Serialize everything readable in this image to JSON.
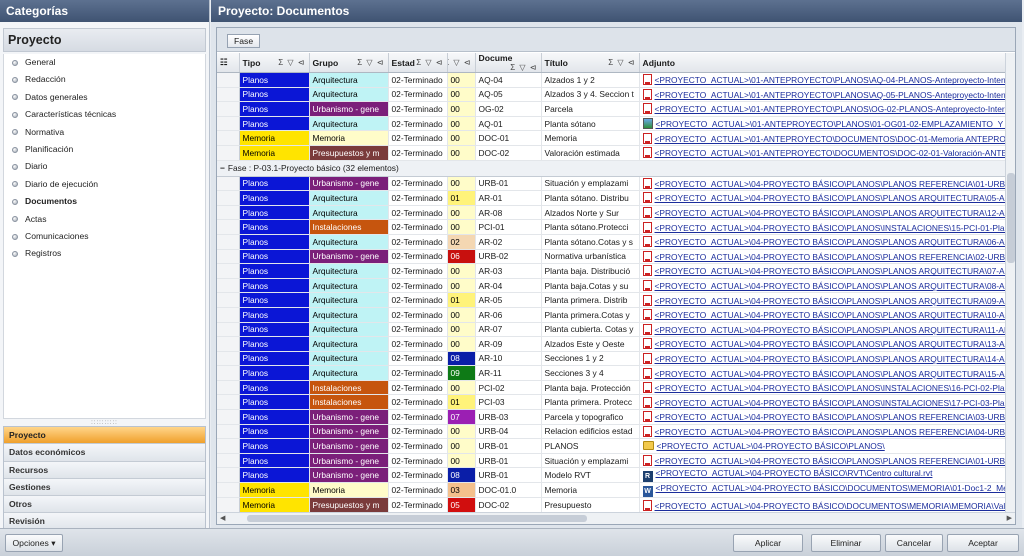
{
  "left_panel": {
    "header": "Categorías",
    "project_title": "Proyecto",
    "nav_items": [
      "General",
      "Redacción",
      "Datos generales",
      "Características técnicas",
      "Normativa",
      "Planificación",
      "Diario",
      "Diario de ejecución",
      "Documentos",
      "Actas",
      "Comunicaciones",
      "Registros"
    ],
    "active_item": "Documentos",
    "grip": "::::::::::",
    "bottom_nav": [
      "Proyecto",
      "Datos económicos",
      "Recursos",
      "Gestiones",
      "Otros",
      "Revisión"
    ],
    "bottom_active": "Proyecto"
  },
  "main": {
    "header": "Proyecto: Documentos",
    "group_chip": "Fase",
    "columns": [
      "Tipo",
      "Grupo",
      "Estad",
      "",
      "Docume",
      "Título",
      "Adjunto"
    ],
    "header_icons": "Σ ▽ ⊲",
    "rows_top": [
      {
        "tipo": "Planos",
        "tipo_color": "#0b16d6",
        "grupo": "Arquitectura",
        "grupo_color": "#bff3f5",
        "estado": "02-Terminado",
        "num": "00",
        "num_color": "#fffcc9",
        "doc": "AQ-04",
        "titulo": "Alzados 1 y 2",
        "icon": "pdf",
        "adjunto": "<PROYECTO_ACTUAL>\\01-ANTEPROYECTO\\PLANOS\\AQ-04-PLANOS-Anteproyecto-Internado.pdf"
      },
      {
        "tipo": "Planos",
        "tipo_color": "#0b16d6",
        "grupo": "Arquitectura",
        "grupo_color": "#bff3f5",
        "estado": "02-Terminado",
        "num": "00",
        "num_color": "#fffcc9",
        "doc": "AQ-05",
        "titulo": "Alzados 3 y 4. Seccion t",
        "icon": "pdf",
        "adjunto": "<PROYECTO_ACTUAL>\\01-ANTEPROYECTO\\PLANOS\\AQ-05-PLANOS-Anteproyecto-Internado.pdf"
      },
      {
        "tipo": "Planos",
        "tipo_color": "#0b16d6",
        "grupo": "Urbanismo - gene",
        "grupo_color": "#7b1f7a",
        "estado": "02-Terminado",
        "num": "00",
        "num_color": "#fffcc9",
        "doc": "OG-02",
        "titulo": "Parcela",
        "icon": "pdf",
        "adjunto": "<PROYECTO_ACTUAL>\\01-ANTEPROYECTO\\PLANOS\\OG-02-PLANOS-Anteproyecto-Internado.pdf"
      },
      {
        "tipo": "Planos",
        "tipo_color": "#0b16d6",
        "grupo": "Arquitectura",
        "grupo_color": "#bff3f5",
        "estado": "02-Terminado",
        "num": "00",
        "num_color": "#fffcc9",
        "doc": "AQ-01",
        "titulo": "Planta sótano",
        "icon": "img",
        "adjunto": "<PROYECTO_ACTUAL>\\01-ANTEPROYECTO\\PLANOS\\01-OG01-02-EMPLAZAMIENTO_Y_SITUACION"
      },
      {
        "tipo": "Memoria",
        "tipo_color": "#ffe400",
        "grupo": "Memoria",
        "grupo_color": "#fffcc9",
        "estado": "02-Terminado",
        "num": "00",
        "num_color": "#fffcc9",
        "doc": "DOC-01",
        "titulo": "Memoria",
        "icon": "pdf",
        "adjunto": "<PROYECTO_ACTUAL>\\01-ANTEPROYECTO\\DOCUMENTOS\\DOC-01-Memoria ANTEPROYECTO-Inter"
      },
      {
        "tipo": "Memoria",
        "tipo_color": "#ffe400",
        "grupo": "Presupuestos y m",
        "grupo_color": "#7a3b3b",
        "estado": "02-Terminado",
        "num": "00",
        "num_color": "#fffcc9",
        "doc": "DOC-02",
        "titulo": "Valoración estimada",
        "icon": "pdf",
        "adjunto": "<PROYECTO_ACTUAL>\\01-ANTEPROYECTO\\DOCUMENTOS\\DOC-02-01-Valoración-ANTEPROY"
      }
    ],
    "group_row": "Fase : P-03.1-Proyecto básico (32 elementos)",
    "rows_bottom": [
      {
        "tipo": "Planos",
        "tipo_color": "#0b16d6",
        "grupo": "Urbanismo - gene",
        "grupo_color": "#7b1f7a",
        "estado": "02-Terminado",
        "num": "00",
        "num_color": "#fffcc9",
        "doc": "URB-01",
        "titulo": "Situación y emplazami",
        "icon": "pdf",
        "adjunto": "<PROYECTO_ACTUAL>\\04-PROYECTO BÁSICO\\PLANOS\\PLANOS REFERENCIA\\01-URB-01-Situac"
      },
      {
        "tipo": "Planos",
        "tipo_color": "#0b16d6",
        "grupo": "Arquitectura",
        "grupo_color": "#bff3f5",
        "estado": "02-Terminado",
        "num": "01",
        "num_color": "#fff37a",
        "doc": "AR-01",
        "titulo": "Planta sótano. Distribu",
        "icon": "pdf",
        "adjunto": "<PROYECTO_ACTUAL>\\04-PROYECTO BÁSICO\\PLANOS\\PLANOS ARQUITECTURA\\05-AR-01-Plan"
      },
      {
        "tipo": "Planos",
        "tipo_color": "#0b16d6",
        "grupo": "Arquitectura",
        "grupo_color": "#bff3f5",
        "estado": "02-Terminado",
        "num": "00",
        "num_color": "#fffcc9",
        "doc": "AR-08",
        "titulo": "Alzados Norte y Sur",
        "icon": "pdf",
        "adjunto": "<PROYECTO_ACTUAL>\\04-PROYECTO BÁSICO\\PLANOS\\PLANOS ARQUITECTURA\\12-AR-08-ALZ"
      },
      {
        "tipo": "Planos",
        "tipo_color": "#0b16d6",
        "grupo": "Instalaciones",
        "grupo_color": "#c6550e",
        "estado": "02-Terminado",
        "num": "00",
        "num_color": "#fffcc9",
        "doc": "PCI-01",
        "titulo": "Planta sótano.Protecci",
        "icon": "pdf",
        "adjunto": "<PROYECTO_ACTUAL>\\04-PROYECTO BÁSICO\\PLANOS\\INSTALACIONES\\15-PCI-01-Planta sotar"
      },
      {
        "tipo": "Planos",
        "tipo_color": "#0b16d6",
        "grupo": "Arquitectura",
        "grupo_color": "#bff3f5",
        "estado": "02-Terminado",
        "num": "02",
        "num_color": "#f4d7b2",
        "doc": "AR-02",
        "titulo": "Planta sótano.Cotas y s",
        "icon": "pdf",
        "adjunto": "<PROYECTO_ACTUAL>\\04-PROYECTO BÁSICO\\PLANOS\\PLANOS ARQUITECTURA\\06-AR-02-Plan"
      },
      {
        "tipo": "Planos",
        "tipo_color": "#0b16d6",
        "grupo": "Urbanismo - gene",
        "grupo_color": "#7b1f7a",
        "estado": "02-Terminado",
        "num": "06",
        "num_color": "#c8100e",
        "doc": "URB-02",
        "titulo": "Normativa urbanística",
        "icon": "pdf",
        "adjunto": "<PROYECTO_ACTUAL>\\04-PROYECTO BÁSICO\\PLANOS\\PLANOS REFERENCIA\\02-URB-02-Norma"
      },
      {
        "tipo": "Planos",
        "tipo_color": "#0b16d6",
        "grupo": "Arquitectura",
        "grupo_color": "#bff3f5",
        "estado": "02-Terminado",
        "num": "00",
        "num_color": "#fffcc9",
        "doc": "AR-03",
        "titulo": "Planta baja. Distribució",
        "icon": "pdf",
        "adjunto": "<PROYECTO_ACTUAL>\\04-PROYECTO BÁSICO\\PLANOS\\PLANOS ARQUITECTURA\\07-AR-03-Plan"
      },
      {
        "tipo": "Planos",
        "tipo_color": "#0b16d6",
        "grupo": "Arquitectura",
        "grupo_color": "#bff3f5",
        "estado": "02-Terminado",
        "num": "00",
        "num_color": "#fffcc9",
        "doc": "AR-04",
        "titulo": "Planta baja.Cotas y su",
        "icon": "pdf",
        "adjunto": "<PROYECTO_ACTUAL>\\04-PROYECTO BÁSICO\\PLANOS\\PLANOS ARQUITECTURA\\08-AR-04-Plan"
      },
      {
        "tipo": "Planos",
        "tipo_color": "#0b16d6",
        "grupo": "Arquitectura",
        "grupo_color": "#bff3f5",
        "estado": "02-Terminado",
        "num": "01",
        "num_color": "#fff37a",
        "doc": "AR-05",
        "titulo": "Planta primera. Distrib",
        "icon": "pdf",
        "adjunto": "<PROYECTO_ACTUAL>\\04-PROYECTO BÁSICO\\PLANOS\\PLANOS ARQUITECTURA\\09-AR-05-Plan"
      },
      {
        "tipo": "Planos",
        "tipo_color": "#0b16d6",
        "grupo": "Arquitectura",
        "grupo_color": "#bff3f5",
        "estado": "02-Terminado",
        "num": "00",
        "num_color": "#fffcc9",
        "doc": "AR-06",
        "titulo": "Planta primera.Cotas y",
        "icon": "pdf",
        "adjunto": "<PROYECTO_ACTUAL>\\04-PROYECTO BÁSICO\\PLANOS\\PLANOS ARQUITECTURA\\10-AR-06-Plan"
      },
      {
        "tipo": "Planos",
        "tipo_color": "#0b16d6",
        "grupo": "Arquitectura",
        "grupo_color": "#bff3f5",
        "estado": "02-Terminado",
        "num": "00",
        "num_color": "#fffcc9",
        "doc": "AR-07",
        "titulo": "Planta cubierta. Cotas y",
        "icon": "pdf",
        "adjunto": "<PROYECTO_ACTUAL>\\04-PROYECTO BÁSICO\\PLANOS\\PLANOS ARQUITECTURA\\11-AR-07-Plan"
      },
      {
        "tipo": "Planos",
        "tipo_color": "#0b16d6",
        "grupo": "Arquitectura",
        "grupo_color": "#bff3f5",
        "estado": "02-Terminado",
        "num": "00",
        "num_color": "#fffcc9",
        "doc": "AR-09",
        "titulo": "Alzados Este y Oeste",
        "icon": "pdf",
        "adjunto": "<PROYECTO_ACTUAL>\\04-PROYECTO BÁSICO\\PLANOS\\PLANOS ARQUITECTURA\\13-AR-09-ALZ"
      },
      {
        "tipo": "Planos",
        "tipo_color": "#0b16d6",
        "grupo": "Arquitectura",
        "grupo_color": "#bff3f5",
        "estado": "02-Terminado",
        "num": "08",
        "num_color": "#0a1ea8",
        "doc": "AR-10",
        "titulo": "Secciones 1 y 2",
        "icon": "pdf",
        "adjunto": "<PROYECTO_ACTUAL>\\04-PROYECTO BÁSICO\\PLANOS\\PLANOS ARQUITECTURA\\14-AR-10-SEC"
      },
      {
        "tipo": "Planos",
        "tipo_color": "#0b16d6",
        "grupo": "Arquitectura",
        "grupo_color": "#bff3f5",
        "estado": "02-Terminado",
        "num": "09",
        "num_color": "#0e7a16",
        "doc": "AR-11",
        "titulo": "Secciones 3 y 4",
        "icon": "pdf",
        "adjunto": "<PROYECTO_ACTUAL>\\04-PROYECTO BÁSICO\\PLANOS\\PLANOS ARQUITECTURA\\15-AR-11-SEC"
      },
      {
        "tipo": "Planos",
        "tipo_color": "#0b16d6",
        "grupo": "Instalaciones",
        "grupo_color": "#c6550e",
        "estado": "02-Terminado",
        "num": "00",
        "num_color": "#fffcc9",
        "doc": "PCI-02",
        "titulo": "Planta baja. Protección",
        "icon": "pdf",
        "adjunto": "<PROYECTO_ACTUAL>\\04-PROYECTO BÁSICO\\PLANOS\\INSTALACIONES\\16-PCI-02-Planta baja"
      },
      {
        "tipo": "Planos",
        "tipo_color": "#0b16d6",
        "grupo": "Instalaciones",
        "grupo_color": "#c6550e",
        "estado": "02-Terminado",
        "num": "01",
        "num_color": "#fff37a",
        "doc": "PCI-03",
        "titulo": "Planta primera. Protecc",
        "icon": "pdf",
        "adjunto": "<PROYECTO_ACTUAL>\\04-PROYECTO BÁSICO\\PLANOS\\INSTALACIONES\\17-PCI-03-Planta prim"
      },
      {
        "tipo": "Planos",
        "tipo_color": "#0b16d6",
        "grupo": "Urbanismo - gene",
        "grupo_color": "#7b1f7a",
        "estado": "02-Terminado",
        "num": "07",
        "num_color": "#9b1fb3",
        "doc": "URB-03",
        "titulo": "Parcela y topografico",
        "icon": "pdf",
        "adjunto": "<PROYECTO_ACTUAL>\\04-PROYECTO BÁSICO\\PLANOS\\PLANOS REFERENCIA\\03-URB-03-Parcel"
      },
      {
        "tipo": "Planos",
        "tipo_color": "#0b16d6",
        "grupo": "Urbanismo - gene",
        "grupo_color": "#7b1f7a",
        "estado": "02-Terminado",
        "num": "00",
        "num_color": "#fffcc9",
        "doc": "URB-04",
        "titulo": "Relacion edificios estad",
        "icon": "pdf",
        "adjunto": "<PROYECTO_ACTUAL>\\04-PROYECTO BÁSICO\\PLANOS\\PLANOS REFERENCIA\\04-URB-04-Relaci"
      },
      {
        "tipo": "Planos",
        "tipo_color": "#0b16d6",
        "grupo": "Urbanismo - gene",
        "grupo_color": "#7b1f7a",
        "estado": "02-Terminado",
        "num": "00",
        "num_color": "#fffcc9",
        "doc": "URB-01",
        "titulo": "PLANOS",
        "icon": "folder",
        "adjunto": "<PROYECTO_ACTUAL>\\04-PROYECTO BÁSICO\\PLANOS\\"
      },
      {
        "tipo": "Planos",
        "tipo_color": "#0b16d6",
        "grupo": "Urbanismo - gene",
        "grupo_color": "#7b1f7a",
        "estado": "02-Terminado",
        "num": "00",
        "num_color": "#fffcc9",
        "doc": "URB-01",
        "titulo": "Situación y emplazami",
        "icon": "pdf",
        "adjunto": "<PROYECTO_ACTUAL>\\04-PROYECTO BÁSICO\\PLANOS\\PLANOS REFERENCIA\\01-URB-01-Situac"
      },
      {
        "tipo": "Planos",
        "tipo_color": "#0b16d6",
        "grupo": "Urbanismo - gene",
        "grupo_color": "#7b1f7a",
        "estado": "02-Terminado",
        "num": "08",
        "num_color": "#0a1ea8",
        "doc": "URB-01",
        "titulo": "Modelo RVT",
        "icon": "rvt",
        "adjunto": "<PROYECTO_ACTUAL>\\04-PROYECTO BÁSICO\\RVT\\Centro cultural.rvt"
      },
      {
        "tipo": "Memoria",
        "tipo_color": "#ffe400",
        "grupo": "Memoria",
        "grupo_color": "#fffcc9",
        "estado": "02-Terminado",
        "num": "03",
        "num_color": "#f4c08c",
        "doc": "DOC-01.0",
        "titulo": "Memoria",
        "icon": "word",
        "adjunto": "<PROYECTO_ACTUAL>\\04-PROYECTO BÁSICO\\DOCUMENTOS\\MEMORIA\\01-Doc1-2_Memoria"
      },
      {
        "tipo": "Memoria",
        "tipo_color": "#ffe400",
        "grupo": "Presupuestos y m",
        "grupo_color": "#7a3b3b",
        "estado": "02-Terminado",
        "num": "05",
        "num_color": "#d10e0e",
        "doc": "DOC-02",
        "titulo": "Presupuesto",
        "icon": "pdf",
        "adjunto": "<PROYECTO_ACTUAL>\\04-PROYECTO BÁSICO\\DOCUMENTOS\\MEMORIA\\MEMORIA\\Valoración-BAS-Residenci"
      }
    ]
  },
  "footer": {
    "options_label": "Opciones",
    "apply_label": "Aplicar",
    "delete_label": "Eliminar",
    "cancel_label": "Cancelar",
    "accept_label": "Aceptar"
  }
}
